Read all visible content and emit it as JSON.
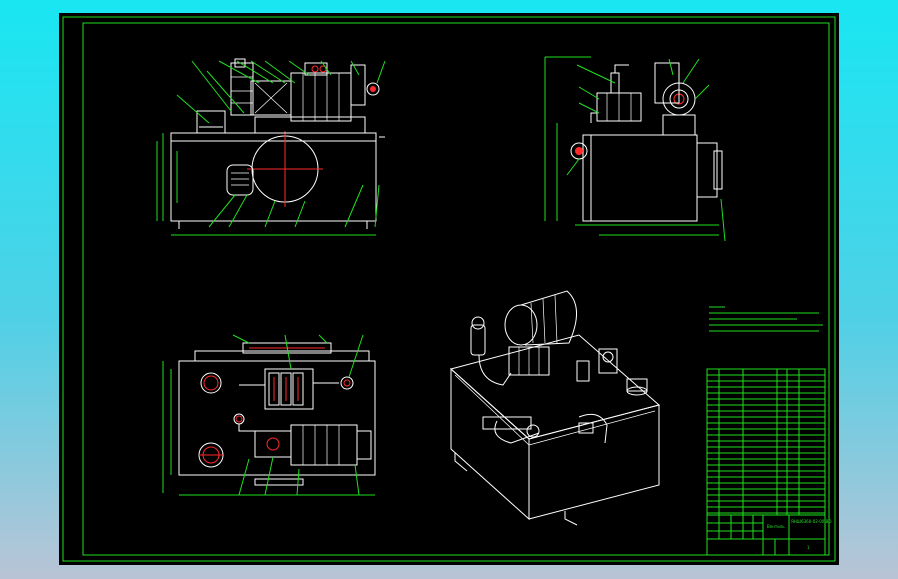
{
  "drawing": {
    "background": "#000000",
    "line_color": "#21e021",
    "part_color": "#ffffff",
    "section_color": "#ff2a2a"
  },
  "title_block": {
    "designation": "Вентиль",
    "drawing_no": "ЯНШ6360-02-00 ВО",
    "sheet": "1",
    "material": "",
    "scale": ""
  }
}
